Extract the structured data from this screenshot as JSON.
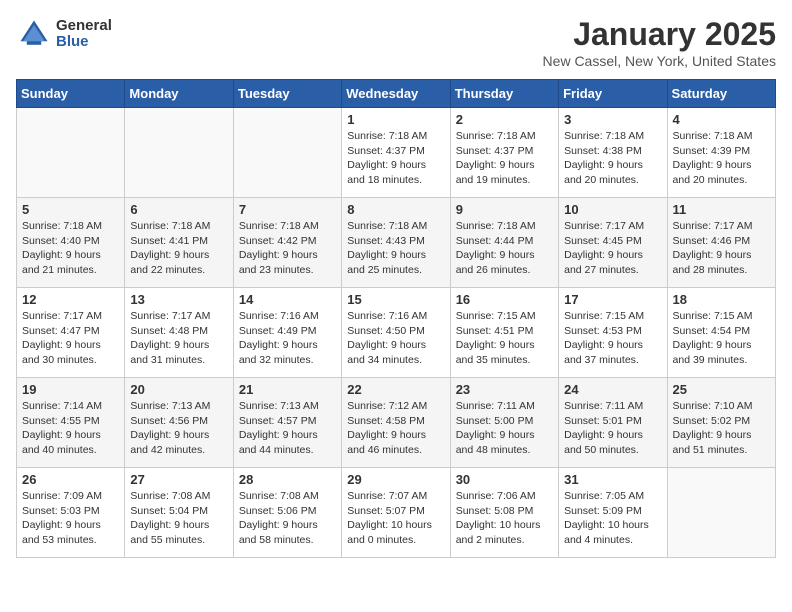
{
  "header": {
    "logo_general": "General",
    "logo_blue": "Blue",
    "month_title": "January 2025",
    "location": "New Cassel, New York, United States"
  },
  "days_of_week": [
    "Sunday",
    "Monday",
    "Tuesday",
    "Wednesday",
    "Thursday",
    "Friday",
    "Saturday"
  ],
  "weeks": [
    [
      {
        "day": "",
        "info": ""
      },
      {
        "day": "",
        "info": ""
      },
      {
        "day": "",
        "info": ""
      },
      {
        "day": "1",
        "info": "Sunrise: 7:18 AM\nSunset: 4:37 PM\nDaylight: 9 hours\nand 18 minutes."
      },
      {
        "day": "2",
        "info": "Sunrise: 7:18 AM\nSunset: 4:37 PM\nDaylight: 9 hours\nand 19 minutes."
      },
      {
        "day": "3",
        "info": "Sunrise: 7:18 AM\nSunset: 4:38 PM\nDaylight: 9 hours\nand 20 minutes."
      },
      {
        "day": "4",
        "info": "Sunrise: 7:18 AM\nSunset: 4:39 PM\nDaylight: 9 hours\nand 20 minutes."
      }
    ],
    [
      {
        "day": "5",
        "info": "Sunrise: 7:18 AM\nSunset: 4:40 PM\nDaylight: 9 hours\nand 21 minutes."
      },
      {
        "day": "6",
        "info": "Sunrise: 7:18 AM\nSunset: 4:41 PM\nDaylight: 9 hours\nand 22 minutes."
      },
      {
        "day": "7",
        "info": "Sunrise: 7:18 AM\nSunset: 4:42 PM\nDaylight: 9 hours\nand 23 minutes."
      },
      {
        "day": "8",
        "info": "Sunrise: 7:18 AM\nSunset: 4:43 PM\nDaylight: 9 hours\nand 25 minutes."
      },
      {
        "day": "9",
        "info": "Sunrise: 7:18 AM\nSunset: 4:44 PM\nDaylight: 9 hours\nand 26 minutes."
      },
      {
        "day": "10",
        "info": "Sunrise: 7:17 AM\nSunset: 4:45 PM\nDaylight: 9 hours\nand 27 minutes."
      },
      {
        "day": "11",
        "info": "Sunrise: 7:17 AM\nSunset: 4:46 PM\nDaylight: 9 hours\nand 28 minutes."
      }
    ],
    [
      {
        "day": "12",
        "info": "Sunrise: 7:17 AM\nSunset: 4:47 PM\nDaylight: 9 hours\nand 30 minutes."
      },
      {
        "day": "13",
        "info": "Sunrise: 7:17 AM\nSunset: 4:48 PM\nDaylight: 9 hours\nand 31 minutes."
      },
      {
        "day": "14",
        "info": "Sunrise: 7:16 AM\nSunset: 4:49 PM\nDaylight: 9 hours\nand 32 minutes."
      },
      {
        "day": "15",
        "info": "Sunrise: 7:16 AM\nSunset: 4:50 PM\nDaylight: 9 hours\nand 34 minutes."
      },
      {
        "day": "16",
        "info": "Sunrise: 7:15 AM\nSunset: 4:51 PM\nDaylight: 9 hours\nand 35 minutes."
      },
      {
        "day": "17",
        "info": "Sunrise: 7:15 AM\nSunset: 4:53 PM\nDaylight: 9 hours\nand 37 minutes."
      },
      {
        "day": "18",
        "info": "Sunrise: 7:15 AM\nSunset: 4:54 PM\nDaylight: 9 hours\nand 39 minutes."
      }
    ],
    [
      {
        "day": "19",
        "info": "Sunrise: 7:14 AM\nSunset: 4:55 PM\nDaylight: 9 hours\nand 40 minutes."
      },
      {
        "day": "20",
        "info": "Sunrise: 7:13 AM\nSunset: 4:56 PM\nDaylight: 9 hours\nand 42 minutes."
      },
      {
        "day": "21",
        "info": "Sunrise: 7:13 AM\nSunset: 4:57 PM\nDaylight: 9 hours\nand 44 minutes."
      },
      {
        "day": "22",
        "info": "Sunrise: 7:12 AM\nSunset: 4:58 PM\nDaylight: 9 hours\nand 46 minutes."
      },
      {
        "day": "23",
        "info": "Sunrise: 7:11 AM\nSunset: 5:00 PM\nDaylight: 9 hours\nand 48 minutes."
      },
      {
        "day": "24",
        "info": "Sunrise: 7:11 AM\nSunset: 5:01 PM\nDaylight: 9 hours\nand 50 minutes."
      },
      {
        "day": "25",
        "info": "Sunrise: 7:10 AM\nSunset: 5:02 PM\nDaylight: 9 hours\nand 51 minutes."
      }
    ],
    [
      {
        "day": "26",
        "info": "Sunrise: 7:09 AM\nSunset: 5:03 PM\nDaylight: 9 hours\nand 53 minutes."
      },
      {
        "day": "27",
        "info": "Sunrise: 7:08 AM\nSunset: 5:04 PM\nDaylight: 9 hours\nand 55 minutes."
      },
      {
        "day": "28",
        "info": "Sunrise: 7:08 AM\nSunset: 5:06 PM\nDaylight: 9 hours\nand 58 minutes."
      },
      {
        "day": "29",
        "info": "Sunrise: 7:07 AM\nSunset: 5:07 PM\nDaylight: 10 hours\nand 0 minutes."
      },
      {
        "day": "30",
        "info": "Sunrise: 7:06 AM\nSunset: 5:08 PM\nDaylight: 10 hours\nand 2 minutes."
      },
      {
        "day": "31",
        "info": "Sunrise: 7:05 AM\nSunset: 5:09 PM\nDaylight: 10 hours\nand 4 minutes."
      },
      {
        "day": "",
        "info": ""
      }
    ]
  ]
}
